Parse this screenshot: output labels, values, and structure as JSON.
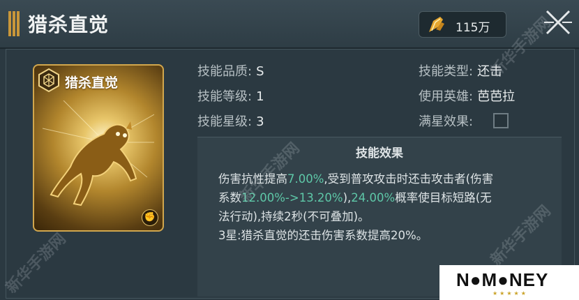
{
  "header": {
    "title": "猎杀直觉",
    "currency_value": "115万",
    "currency_icon": "gold-feather-icon",
    "close_icon": "close-icon"
  },
  "card": {
    "name": "猎杀直觉",
    "hex_icon": "skill-hex-icon",
    "art": "golden-panther-art",
    "badge_icon": "fist-icon"
  },
  "attributes": {
    "left": [
      {
        "label": "技能品质:",
        "value": "S"
      },
      {
        "label": "技能等级:",
        "value": "1"
      },
      {
        "label": "技能星级:",
        "value": "3"
      }
    ],
    "right": [
      {
        "label": "技能类型:",
        "value": "还击"
      },
      {
        "label": "使用英雄:",
        "value": "芭芭拉"
      },
      {
        "label": "满星效果:",
        "value": ""
      }
    ]
  },
  "effect": {
    "title": "技能效果",
    "line1_a": "伤害抗性提高",
    "line1_hl": "7.00%",
    "line1_b": ",受到普攻攻击时还击攻击者(伤害",
    "line2_a": "系数",
    "line2_hl1": "12.00%->13.20%",
    "line2_b": "),",
    "line2_hl2": "24.00%",
    "line2_c": "概率使目标短路(无",
    "line3": "法行动),持续2秒(不可叠加)。",
    "line4": "3星:猎杀直觉的还击伤害系数提高20%。"
  },
  "watermark": "新华手游网",
  "logo": {
    "text": "N●M●NEY",
    "stars": "★★★★★"
  },
  "colors": {
    "accent_gold": "#d2a74d",
    "highlight_green": "#5ec8a8",
    "background": "#2b3941"
  }
}
